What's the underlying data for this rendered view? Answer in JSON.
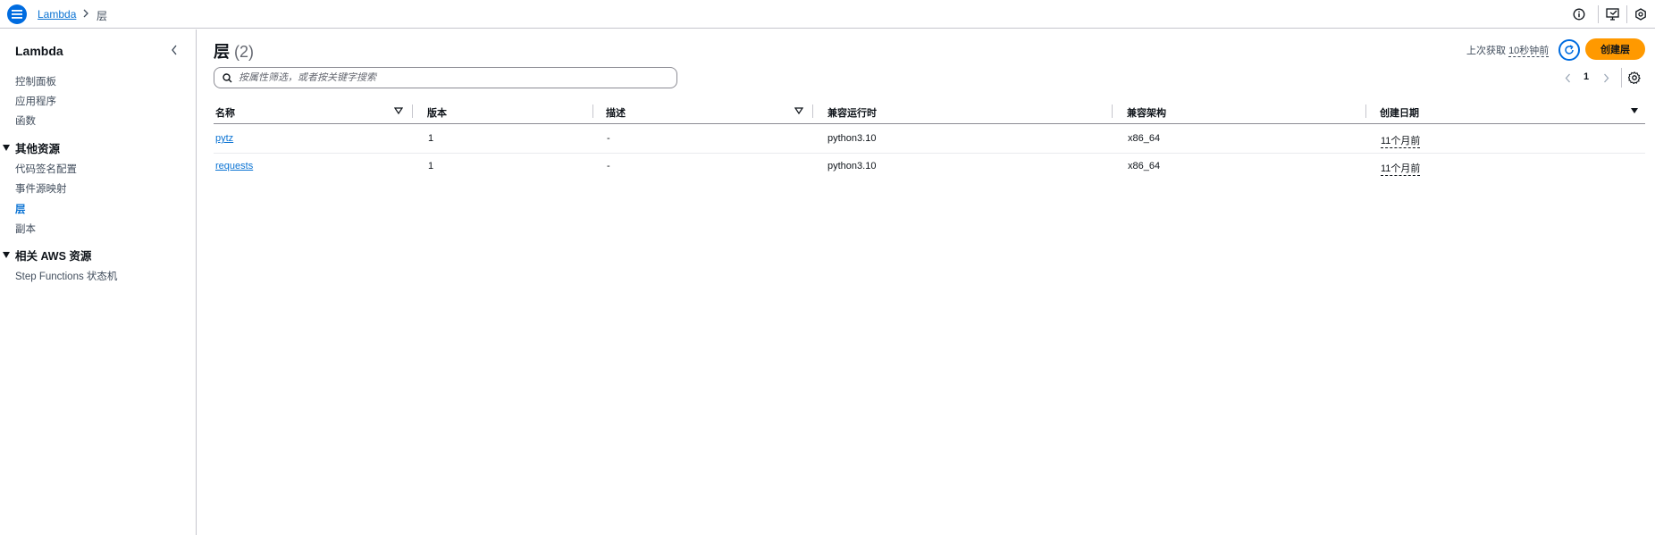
{
  "topbar": {
    "breadcrumb_root": "Lambda",
    "breadcrumb_current": "层",
    "icons": [
      "menu-icon",
      "info-icon",
      "feedback-icon",
      "settings-hex-icon"
    ]
  },
  "sidebar": {
    "title": "Lambda",
    "items": [
      {
        "label": "控制面板"
      },
      {
        "label": "应用程序"
      },
      {
        "label": "函数"
      }
    ],
    "section_other": "其他资源",
    "other_items": [
      {
        "label": "代码签名配置"
      },
      {
        "label": "事件源映射"
      },
      {
        "label": "层",
        "active": true
      },
      {
        "label": "副本"
      }
    ],
    "section_related": "相关 AWS 资源",
    "related_items": [
      {
        "label": "Step Functions 状态机"
      }
    ]
  },
  "main": {
    "title": "层",
    "count": "(2)",
    "last_fetched_label": "上次获取",
    "last_fetched_value": "10秒钟前",
    "create_button": "创建层",
    "search_placeholder": "按属性筛选，或者按关键字搜索",
    "page_number": "1"
  },
  "table": {
    "columns": [
      "名称",
      "版本",
      "描述",
      "兼容运行时",
      "兼容架构",
      "创建日期"
    ],
    "rows": [
      {
        "name": "pytz",
        "version": "1",
        "description": "-",
        "runtime": "python3.10",
        "arch": "x86_64",
        "created": "11个月前"
      },
      {
        "name": "requests",
        "version": "1",
        "description": "-",
        "runtime": "python3.10",
        "arch": "x86_64",
        "created": "11个月前"
      }
    ]
  },
  "colors": {
    "accent": "#006ce0",
    "link": "#0972d3",
    "primary_button": "#ff9900"
  }
}
